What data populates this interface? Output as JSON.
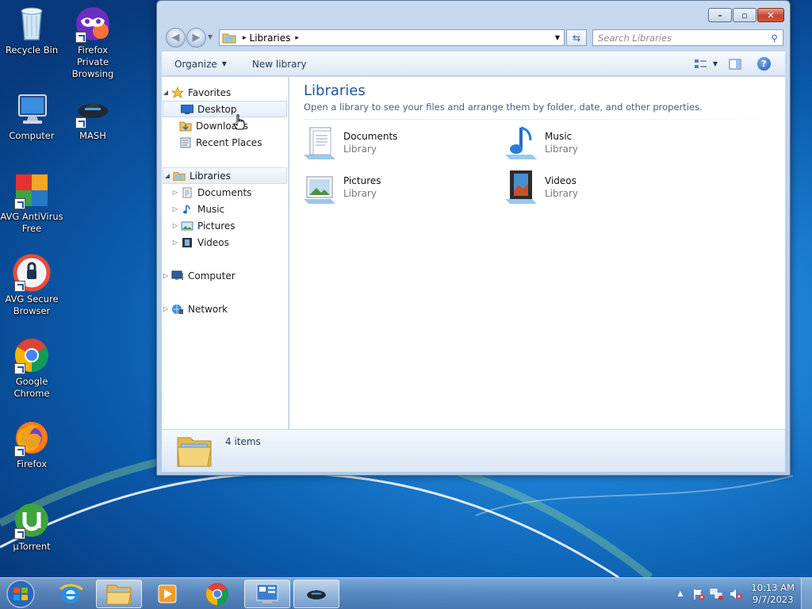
{
  "desktop": {
    "icons": [
      {
        "label": "Recycle Bin",
        "icon": "recycle-bin-icon"
      },
      {
        "label": "Firefox Private Browsing",
        "icon": "firefox-private-icon"
      },
      {
        "label": "Computer",
        "icon": "computer-icon"
      },
      {
        "label": "MASH",
        "icon": "mash-icon"
      },
      {
        "label": "AVG AntiVirus Free",
        "icon": "avg-antivirus-icon"
      },
      {
        "label": "AVG Secure Browser",
        "icon": "avg-secure-browser-icon"
      },
      {
        "label": "Google Chrome",
        "icon": "chrome-icon"
      },
      {
        "label": "Firefox",
        "icon": "firefox-icon"
      },
      {
        "label": "µTorrent",
        "icon": "utorrent-icon"
      }
    ]
  },
  "window": {
    "controls": {
      "minimize": "–",
      "maximize": "▫",
      "close": "✕"
    },
    "address": {
      "crumb": "Libraries",
      "sep": "▸"
    },
    "search": {
      "placeholder": "Search Libraries"
    },
    "toolbar": {
      "organize": "Organize",
      "new_library": "New library"
    },
    "nav": {
      "favorites": "Favorites",
      "desktop": "Desktop",
      "downloads": "Downloads",
      "recent_places": "Recent Places",
      "libraries": "Libraries",
      "documents": "Documents",
      "music": "Music",
      "pictures": "Pictures",
      "videos": "Videos",
      "computer": "Computer",
      "network": "Network"
    },
    "content": {
      "title": "Libraries",
      "subtitle": "Open a library to see your files and arrange them by folder, date, and other properties.",
      "items": [
        {
          "name": "Documents",
          "type": "Library"
        },
        {
          "name": "Music",
          "type": "Library"
        },
        {
          "name": "Pictures",
          "type": "Library"
        },
        {
          "name": "Videos",
          "type": "Library"
        }
      ]
    },
    "details": {
      "count": "4 items"
    }
  },
  "taskbar": {
    "clock": {
      "time": "10:13 AM",
      "date": "9/7/2023"
    },
    "tray_arrow": "▲"
  },
  "colors": {
    "accent": "#1e5799",
    "window_frame": "#b3cbe6",
    "close_red": "#c7452c"
  }
}
